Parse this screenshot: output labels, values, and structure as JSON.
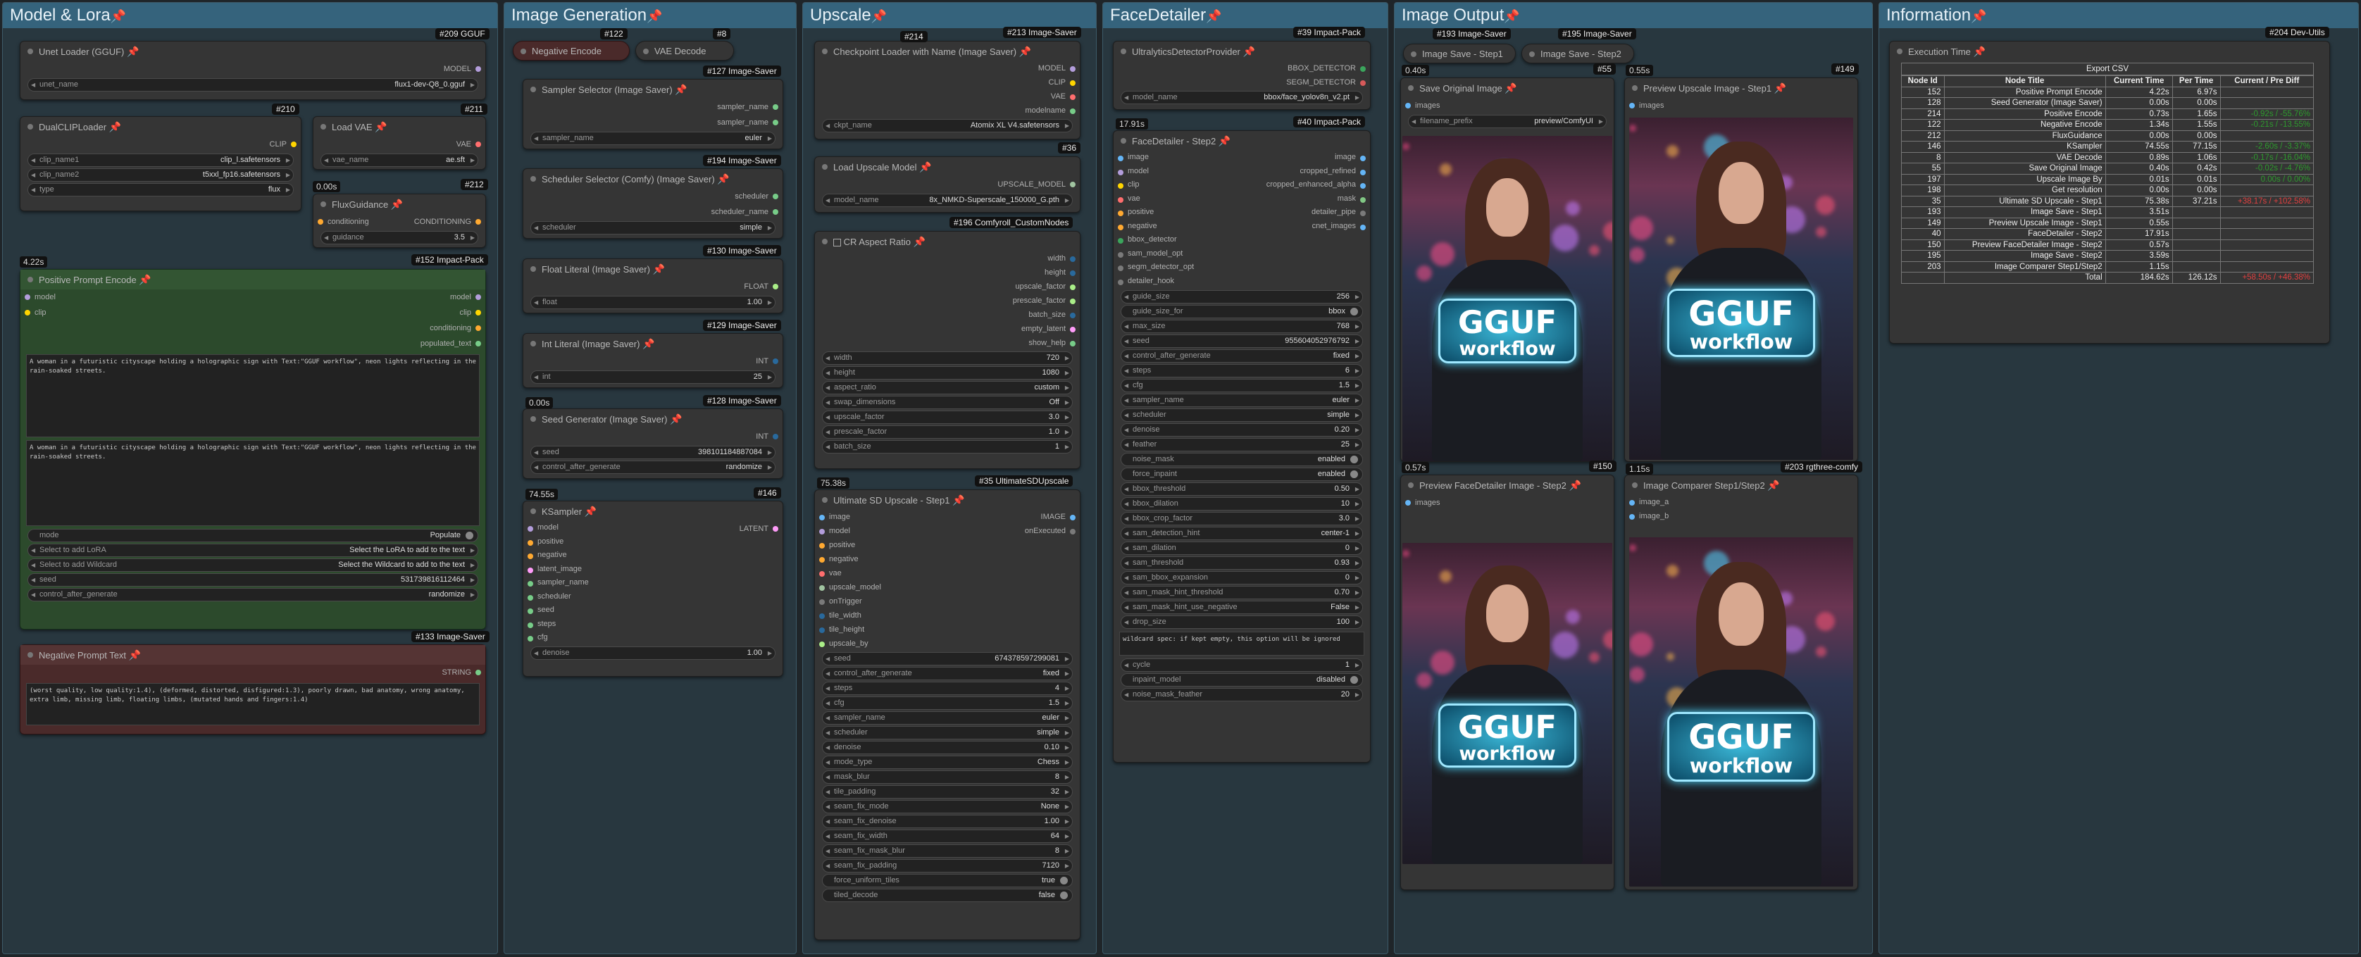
{
  "groups": [
    {
      "title": "Model & Lora"
    },
    {
      "title": "Image Generation"
    },
    {
      "title": "Upscale"
    },
    {
      "title": "FaceDetailer"
    },
    {
      "title": "Image Output"
    },
    {
      "title": "Information"
    }
  ],
  "nodes": {
    "unet": {
      "badge": "#209 GGUF",
      "title": "Unet Loader (GGUF)",
      "out": "MODEL",
      "w": [
        {
          "k": "unet_name",
          "v": "flux1-dev-Q8_0.gguf"
        }
      ]
    },
    "dualclip": {
      "badge": "#210",
      "title": "DualCLIPLoader",
      "out": "CLIP",
      "w": [
        {
          "k": "clip_name1",
          "v": "clip_l.safetensors"
        },
        {
          "k": "clip_name2",
          "v": "t5xxl_fp16.safetensors"
        },
        {
          "k": "type",
          "v": "flux"
        }
      ]
    },
    "vae": {
      "badge": "#211",
      "title": "Load VAE",
      "out": "VAE",
      "w": [
        {
          "k": "vae_name",
          "v": "ae.sft"
        }
      ]
    },
    "fluxg": {
      "badge": "#212",
      "time": "0.00s",
      "title": "FluxGuidance",
      "in": "conditioning",
      "out": "CONDITIONING",
      "w": [
        {
          "k": "guidance",
          "v": "3.5"
        }
      ]
    },
    "pos": {
      "badge": "#152 Impact-Pack",
      "time": "4.22s",
      "title": "Positive Prompt Encode",
      "ins": [
        "model",
        "clip"
      ],
      "outs": [
        "model",
        "clip",
        "conditioning",
        "populated_text"
      ],
      "text1": "A woman in a futuristic cityscape holding a holographic sign with Text:\"GGUF workflow\", neon lights reflecting in the rain-soaked streets.",
      "text2": "A woman in a futuristic cityscape holding a holographic sign with Text:\"GGUF workflow\", neon lights reflecting in the rain-soaked streets.",
      "mode": "mode",
      "mode_v": "Populate",
      "lora": "Select to add LoRA",
      "lora_v": "Select the LoRA to add to the text",
      "wild": "Select to add Wildcard",
      "wild_v": "Select the Wildcard to add to the text",
      "seed_k": "seed",
      "seed_v": "531739816112464",
      "cag_k": "control_after_generate",
      "cag_v": "randomize"
    },
    "neg": {
      "badge": "#133 Image-Saver",
      "title": "Negative Prompt Text",
      "out": "STRING",
      "text": "(worst quality, low quality:1.4), (deformed, distorted, disfigured:1.3), poorly drawn, bad anatomy, wrong anatomy, extra limb, missing limb, floating limbs, (mutated hands and fingers:1.4)"
    },
    "negenc": {
      "badge": "#122",
      "title": "Negative Encode"
    },
    "vaedec": {
      "badge": "#8",
      "title": "VAE Decode"
    },
    "sampsel": {
      "badge": "#127 Image-Saver",
      "title": "Sampler Selector (Image Saver)",
      "outs": [
        "sampler_name",
        "sampler_name"
      ],
      "w": [
        {
          "k": "sampler_name",
          "v": "euler"
        }
      ]
    },
    "schedsel": {
      "badge": "#194 Image-Saver",
      "title": "Scheduler Selector (Comfy) (Image Saver)",
      "outs": [
        "scheduler",
        "scheduler_name"
      ],
      "w": [
        {
          "k": "scheduler",
          "v": "simple"
        }
      ]
    },
    "floatlit": {
      "badge": "#130 Image-Saver",
      "title": "Float Literal (Image Saver)",
      "out": "FLOAT",
      "w": [
        {
          "k": "float",
          "v": "1.00"
        }
      ]
    },
    "intlit": {
      "badge": "#129 Image-Saver",
      "title": "Int Literal (Image Saver)",
      "out": "INT",
      "w": [
        {
          "k": "int",
          "v": "25"
        }
      ]
    },
    "seedgen": {
      "badge": "#128 Image-Saver",
      "time": "0.00s",
      "title": "Seed Generator (Image Saver)",
      "out": "INT",
      "w": [
        {
          "k": "seed",
          "v": "398101184887084"
        },
        {
          "k": "control_after_generate",
          "v": "randomize"
        }
      ]
    },
    "ksampler": {
      "badge": "#146",
      "time": "74.55s",
      "title": "KSampler",
      "ins": [
        "model",
        "positive",
        "negative",
        "latent_image",
        "sampler_name",
        "scheduler",
        "seed",
        "steps",
        "cfg"
      ],
      "out": "LATENT",
      "w": [
        {
          "k": "denoise",
          "v": "1.00"
        }
      ]
    },
    "ckpt": {
      "badge": "#213 Image-Saver",
      "badge2": "#214",
      "title": "Checkpoint Loader with Name (Image Saver)",
      "outs": [
        "MODEL",
        "CLIP",
        "VAE",
        "modelname"
      ],
      "w": [
        {
          "k": "ckpt_name",
          "v": "Atomix XL V4.safetensors"
        }
      ]
    },
    "upmodel": {
      "badge": "#36",
      "title": "Load Upscale Model",
      "out": "UPSCALE_MODEL",
      "w": [
        {
          "k": "model_name",
          "v": "8x_NMKD-Superscale_150000_G.pth"
        }
      ]
    },
    "cr": {
      "badge": "#196 Comfyroll_CustomNodes",
      "title": "CR Aspect Ratio",
      "outs": [
        "width",
        "height",
        "upscale_factor",
        "prescale_factor",
        "batch_size",
        "empty_latent",
        "show_help"
      ],
      "w": [
        {
          "k": "width",
          "v": "720"
        },
        {
          "k": "height",
          "v": "1080"
        },
        {
          "k": "aspect_ratio",
          "v": "custom"
        },
        {
          "k": "swap_dimensions",
          "v": "Off"
        },
        {
          "k": "upscale_factor",
          "v": "3.0"
        },
        {
          "k": "prescale_factor",
          "v": "1.0"
        },
        {
          "k": "batch_size",
          "v": "1"
        }
      ]
    },
    "usd": {
      "badge": "#35 UltimateSDUpscale",
      "time": "75.38s",
      "title": "Ultimate SD Upscale - Step1",
      "ins": [
        "image",
        "model",
        "positive",
        "negative",
        "vae",
        "upscale_model",
        "onTrigger",
        "tile_width",
        "tile_height",
        "upscale_by"
      ],
      "outs": [
        "IMAGE",
        "onExecuted"
      ],
      "w": [
        {
          "k": "seed",
          "v": "674378597299081"
        },
        {
          "k": "control_after_generate",
          "v": "fixed"
        },
        {
          "k": "steps",
          "v": "4"
        },
        {
          "k": "cfg",
          "v": "1.5"
        },
        {
          "k": "sampler_name",
          "v": "euler"
        },
        {
          "k": "scheduler",
          "v": "simple"
        },
        {
          "k": "denoise",
          "v": "0.10"
        },
        {
          "k": "mode_type",
          "v": "Chess"
        },
        {
          "k": "mask_blur",
          "v": "8"
        },
        {
          "k": "tile_padding",
          "v": "32"
        },
        {
          "k": "seam_fix_mode",
          "v": "None"
        },
        {
          "k": "seam_fix_denoise",
          "v": "1.00"
        },
        {
          "k": "seam_fix_width",
          "v": "64"
        },
        {
          "k": "seam_fix_mask_blur",
          "v": "8"
        },
        {
          "k": "seam_fix_padding",
          "v": "7120"
        }
      ],
      "toggles": [
        {
          "k": "force_uniform_tiles",
          "v": "true"
        },
        {
          "k": "tiled_decode",
          "v": "false"
        }
      ]
    },
    "ultra": {
      "badge": "#39 Impact-Pack",
      "title": "UltralyticsDetectorProvider",
      "outs": [
        "BBOX_DETECTOR",
        "SEGM_DETECTOR"
      ],
      "w": [
        {
          "k": "model_name",
          "v": "bbox/face_yolov8n_v2.pt"
        }
      ]
    },
    "fd": {
      "badge": "#40 Impact-Pack",
      "time": "17.91s",
      "title": "FaceDetailer - Step2",
      "ins": [
        "image",
        "model",
        "clip",
        "vae",
        "positive",
        "negative",
        "bbox_detector",
        "sam_model_opt",
        "segm_detector_opt",
        "detailer_hook"
      ],
      "outs": [
        "image",
        "cropped_refined",
        "cropped_enhanced_alpha",
        "mask",
        "detailer_pipe",
        "cnet_images"
      ],
      "w": [
        {
          "k": "guide_size",
          "v": "256"
        }
      ],
      "t1": {
        "k": "guide_size_for",
        "v": "bbox"
      },
      "w2": [
        {
          "k": "max_size",
          "v": "768"
        },
        {
          "k": "seed",
          "v": "955604052976792"
        },
        {
          "k": "control_after_generate",
          "v": "fixed"
        },
        {
          "k": "steps",
          "v": "6"
        },
        {
          "k": "cfg",
          "v": "1.5"
        },
        {
          "k": "sampler_name",
          "v": "euler"
        },
        {
          "k": "scheduler",
          "v": "simple"
        },
        {
          "k": "denoise",
          "v": "0.20"
        },
        {
          "k": "feather",
          "v": "25"
        }
      ],
      "t2": [
        {
          "k": "noise_mask",
          "v": "enabled"
        },
        {
          "k": "force_inpaint",
          "v": "enabled"
        }
      ],
      "w3": [
        {
          "k": "bbox_threshold",
          "v": "0.50"
        },
        {
          "k": "bbox_dilation",
          "v": "10"
        },
        {
          "k": "bbox_crop_factor",
          "v": "3.0"
        },
        {
          "k": "sam_detection_hint",
          "v": "center-1"
        },
        {
          "k": "sam_dilation",
          "v": "0"
        },
        {
          "k": "sam_threshold",
          "v": "0.93"
        },
        {
          "k": "sam_bbox_expansion",
          "v": "0"
        },
        {
          "k": "sam_mask_hint_threshold",
          "v": "0.70"
        },
        {
          "k": "sam_mask_hint_use_negative",
          "v": "False"
        },
        {
          "k": "drop_size",
          "v": "100"
        }
      ],
      "wc": "wildcard spec: if kept empty, this option will be ignored",
      "w4": [
        {
          "k": "cycle",
          "v": "1"
        }
      ],
      "t3": [
        {
          "k": "inpaint_model",
          "v": "disabled"
        }
      ],
      "w5": [
        {
          "k": "noise_mask_feather",
          "v": "20"
        }
      ]
    },
    "save1": {
      "badge": "#193 Image-Saver",
      "time": "0.40s",
      "title": "Save Original Image",
      "in": "images",
      "fp_k": "filename_prefix",
      "fp_v": "preview/ComfyUI"
    },
    "save2": {
      "badge": "#195 Image-Saver",
      "badge2": "#149",
      "time": "0.55s",
      "title": "Preview Upscale Image - Step1",
      "in": "images"
    },
    "imgsave1": {
      "title": "Image Save - Step1"
    },
    "imgsave2": {
      "title": "Image Save - Step2"
    },
    "b55": {
      "badge": "#55"
    },
    "prevfd": {
      "badge": "#150",
      "time": "0.57s",
      "title": "Preview FaceDetailer Image - Step2",
      "in": "images"
    },
    "comp": {
      "badge": "#203 rgthree-comfy",
      "time": "1.15s",
      "title": "Image Comparer Step1/Step2",
      "ins": [
        "image_a",
        "image_b"
      ]
    },
    "exec": {
      "badge": "#204 Dev-Utils",
      "title": "Execution Time"
    }
  },
  "images": {
    "sign_l1": "GGUF",
    "sign_l2": "workflow"
  },
  "info": {
    "export": "Export CSV",
    "headers": [
      "Node Id",
      "Node Title",
      "Current Time",
      "Per Time",
      "Current / Pre Diff"
    ],
    "rows": [
      [
        "152",
        "Positive Prompt Encode",
        "4.22s",
        "6.97s",
        ""
      ],
      [
        "128",
        "Seed Generator (Image Saver)",
        "0.00s",
        "0.00s",
        ""
      ],
      [
        "214",
        "Positive Encode",
        "0.73s",
        "1.65s",
        "-0.92s / -55.76%"
      ],
      [
        "122",
        "Negative Encode",
        "1.34s",
        "1.55s",
        "-0.21s / -13.55%"
      ],
      [
        "212",
        "FluxGuidance",
        "0.00s",
        "0.00s",
        ""
      ],
      [
        "146",
        "KSampler",
        "74.55s",
        "77.15s",
        "-2.60s / -3.37%"
      ],
      [
        "8",
        "VAE Decode",
        "0.89s",
        "1.06s",
        "-0.17s / -16.04%"
      ],
      [
        "55",
        "Save Original Image",
        "0.40s",
        "0.42s",
        "-0.02s / -4.76%"
      ],
      [
        "197",
        "Upscale Image By",
        "0.01s",
        "0.01s",
        "0.00s / 0.00%"
      ],
      [
        "198",
        "Get resolution",
        "0.00s",
        "0.00s",
        ""
      ],
      [
        "35",
        "Ultimate SD Upscale - Step1",
        "75.38s",
        "37.21s",
        "+38.17s / +102.58%"
      ],
      [
        "193",
        "Image Save - Step1",
        "3.51s",
        "",
        ""
      ],
      [
        "149",
        "Preview Upscale Image - Step1",
        "0.55s",
        "",
        ""
      ],
      [
        "40",
        "FaceDetailer - Step2",
        "17.91s",
        "",
        ""
      ],
      [
        "150",
        "Preview FaceDetailer Image - Step2",
        "0.57s",
        "",
        ""
      ],
      [
        "195",
        "Image Save - Step2",
        "3.59s",
        "",
        ""
      ],
      [
        "203",
        "Image Comparer Step1/Step2",
        "1.15s",
        "",
        ""
      ],
      [
        "",
        "Total",
        "184.62s",
        "126.12s",
        "+58.50s / +46.38%"
      ]
    ]
  },
  "colors": {
    "group": "#35637c",
    "node": "#353535",
    "green": "#335533",
    "red": "#553434"
  }
}
